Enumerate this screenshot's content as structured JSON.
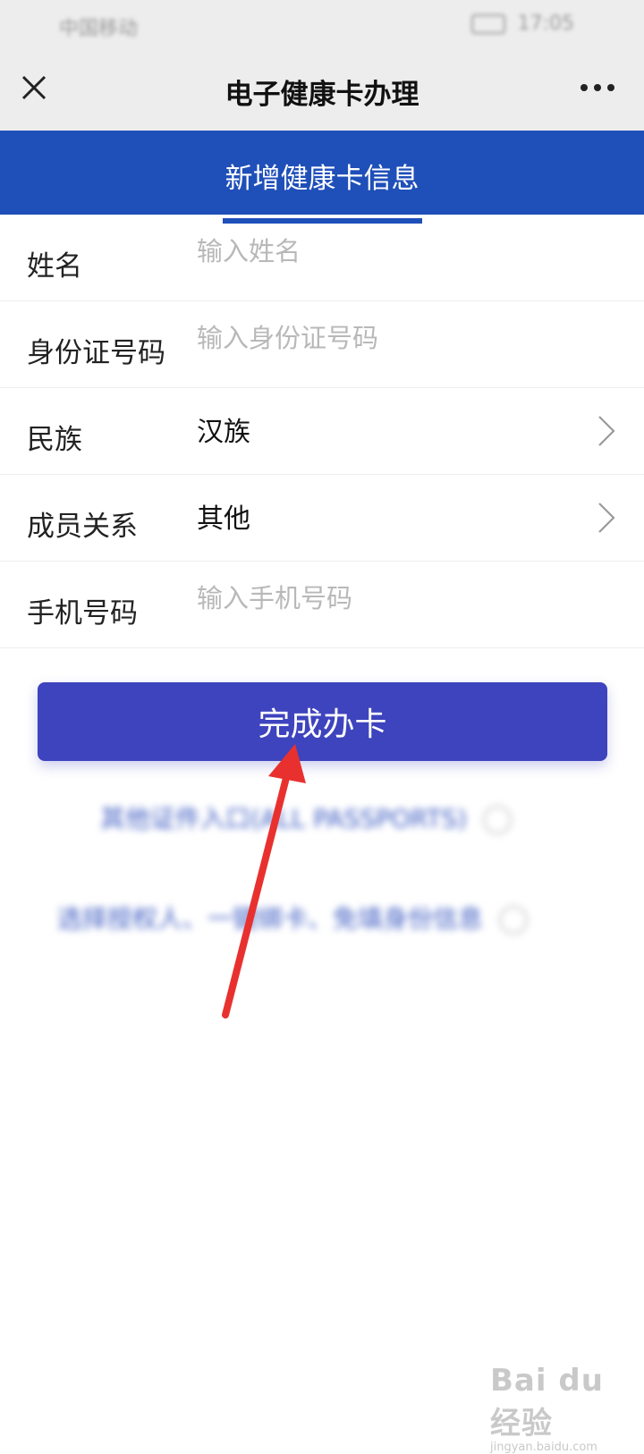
{
  "status_bar": {
    "carrier": "中国移动",
    "time": "17:05"
  },
  "nav": {
    "title": "电子健康卡办理",
    "close_icon": "close-icon",
    "more_icon": "more-icon"
  },
  "tab": {
    "label": "新增健康卡信息"
  },
  "form": {
    "name": {
      "label": "姓名",
      "placeholder": "输入姓名",
      "value": ""
    },
    "id_number": {
      "label": "身份证号码",
      "placeholder": "输入身份证号码",
      "value": ""
    },
    "ethnicity": {
      "label": "民族",
      "value": "汉族"
    },
    "relation": {
      "label": "成员关系",
      "value": "其他"
    },
    "phone": {
      "label": "手机号码",
      "placeholder": "输入手机号码",
      "value": ""
    }
  },
  "submit": {
    "label": "完成办卡"
  },
  "links": {
    "passport": "其他证件入口(ALL PASSPORTS)",
    "authorize": "选择授权人、一键绑卡、免填身份信息"
  },
  "watermark": {
    "main": "Bai du 经验",
    "sub": "jingyan.baidu.com"
  },
  "colors": {
    "tab_blue": "#1f4fb8",
    "button_purple": "#3e43be",
    "arrow_red": "#e8312f"
  }
}
